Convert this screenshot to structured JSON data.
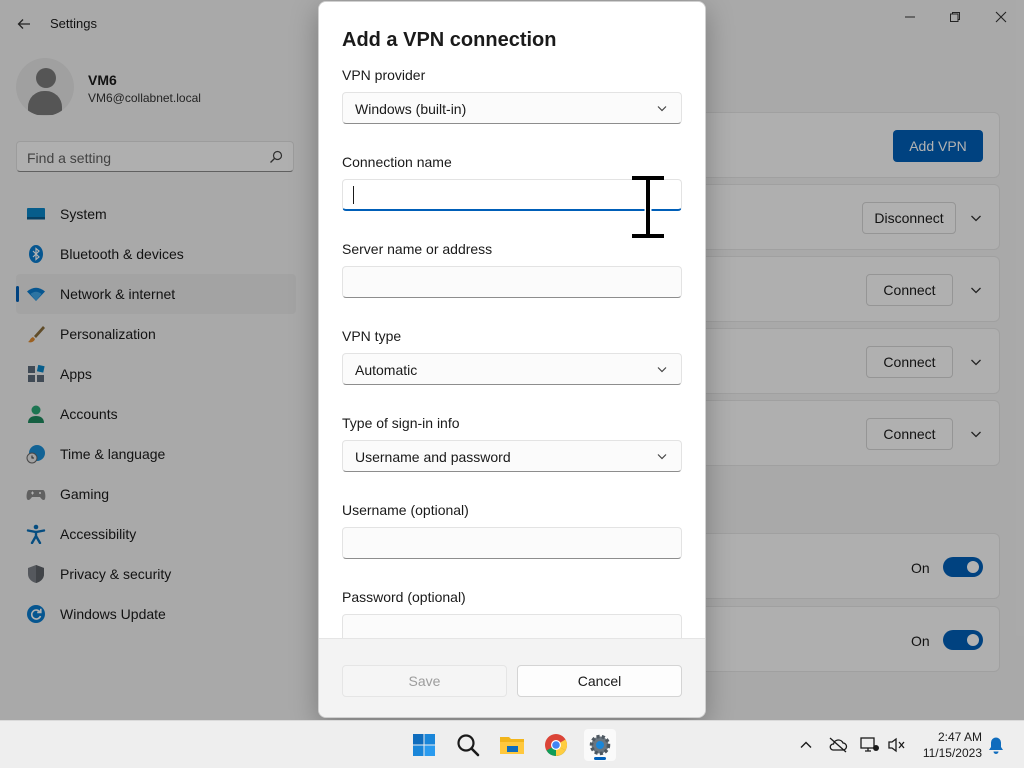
{
  "app": {
    "title": "Settings"
  },
  "profile": {
    "name": "VM6",
    "email": "VM6@collabnet.local"
  },
  "search": {
    "placeholder": "Find a setting"
  },
  "nav": {
    "items": [
      {
        "label": "System",
        "icon": "monitor-icon"
      },
      {
        "label": "Bluetooth & devices",
        "icon": "bluetooth-icon"
      },
      {
        "label": "Network & internet",
        "icon": "wifi-icon",
        "selected": true
      },
      {
        "label": "Personalization",
        "icon": "brush-icon"
      },
      {
        "label": "Apps",
        "icon": "apps-icon"
      },
      {
        "label": "Accounts",
        "icon": "accounts-icon"
      },
      {
        "label": "Time & language",
        "icon": "globe-clock-icon"
      },
      {
        "label": "Gaming",
        "icon": "gamepad-icon"
      },
      {
        "label": "Accessibility",
        "icon": "accessibility-icon"
      },
      {
        "label": "Privacy & security",
        "icon": "shield-icon"
      },
      {
        "label": "Windows Update",
        "icon": "refresh-icon"
      }
    ]
  },
  "main": {
    "add_vpn_label": "Add VPN",
    "disconnect_label": "Disconnect",
    "connect_label": "Connect",
    "toggle_on_label": "On"
  },
  "dialog": {
    "title": "Add a VPN connection",
    "vpn_provider": {
      "label": "VPN provider",
      "value": "Windows (built-in)"
    },
    "connection_name": {
      "label": "Connection name",
      "value": ""
    },
    "server": {
      "label": "Server name or address",
      "value": ""
    },
    "vpn_type": {
      "label": "VPN type",
      "value": "Automatic"
    },
    "signin_type": {
      "label": "Type of sign-in info",
      "value": "Username and password"
    },
    "username": {
      "label": "Username (optional)",
      "value": ""
    },
    "password": {
      "label": "Password (optional)"
    },
    "save_label": "Save",
    "cancel_label": "Cancel"
  },
  "taskbar": {
    "apps": [
      "start-icon",
      "search-icon",
      "file-explorer-icon",
      "chrome-icon",
      "settings-icon"
    ],
    "time": "2:47 AM",
    "date": "11/15/2023"
  },
  "colors": {
    "accent": "#005fb8",
    "scrim": "rgba(0,0,0,0.30)"
  }
}
